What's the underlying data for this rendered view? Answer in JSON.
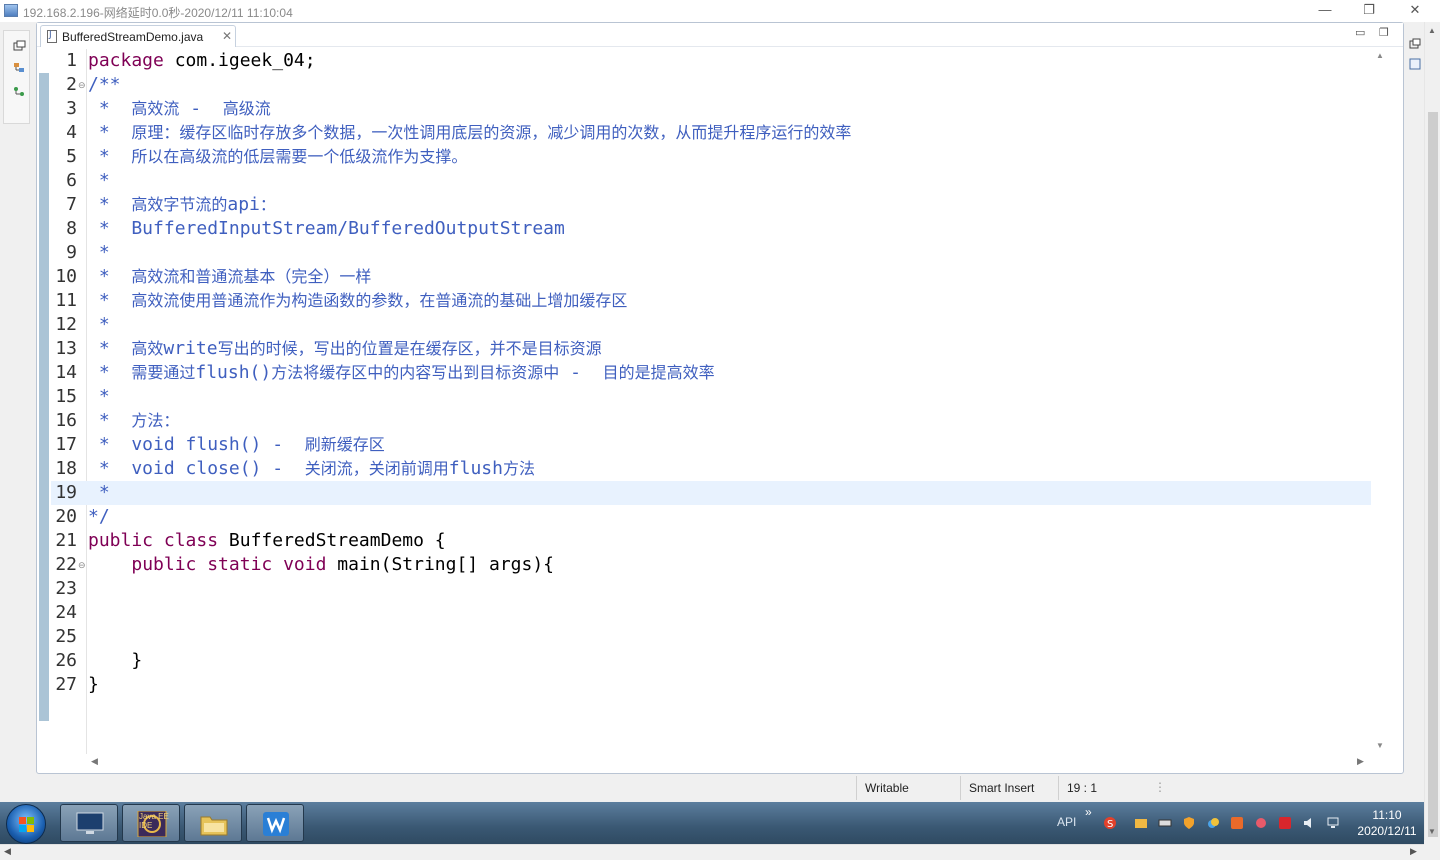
{
  "window": {
    "title": "192.168.2.196-网络延时0.0秒-2020/12/11 11:10:04",
    "minimize_label": "—",
    "restore_label": "❐",
    "close_label": "✕"
  },
  "editor": {
    "tab_label": "BufferedStreamDemo.java",
    "tab_close": "✕",
    "minimize_label": "▭",
    "maximize_label": "❐"
  },
  "code_lines": [
    {
      "n": "1",
      "t": "package com.igeek_04;"
    },
    {
      "n": "2",
      "t": "/**"
    },
    {
      "n": "3",
      "t": " *  高效流 -  高级流"
    },
    {
      "n": "4",
      "t": " *  原理：缓存区临时存放多个数据，一次性调用底层的资源，减少调用的次数，从而提升程序运行的效率"
    },
    {
      "n": "5",
      "t": " *  所以在高级流的低层需要一个低级流作为支撑。"
    },
    {
      "n": "6",
      "t": " *"
    },
    {
      "n": "7",
      "t": " *  高效字节流的api："
    },
    {
      "n": "8",
      "t": " *  BufferedInputStream/BufferedOutputStream"
    },
    {
      "n": "9",
      "t": " *"
    },
    {
      "n": "10",
      "t": " *  高效流和普通流基本（完全）一样"
    },
    {
      "n": "11",
      "t": " *  高效流使用普通流作为构造函数的参数，在普通流的基础上增加缓存区"
    },
    {
      "n": "12",
      "t": " *"
    },
    {
      "n": "13",
      "t": " *  高效write写出的时候，写出的位置是在缓存区，并不是目标资源"
    },
    {
      "n": "14",
      "t": " *  需要通过flush()方法将缓存区中的内容写出到目标资源中 -  目的是提高效率"
    },
    {
      "n": "15",
      "t": " *"
    },
    {
      "n": "16",
      "t": " *  方法："
    },
    {
      "n": "17",
      "t": " *  void flush() -  刷新缓存区"
    },
    {
      "n": "18",
      "t": " *  void close() -  关闭流，关闭前调用flush方法"
    },
    {
      "n": "19",
      "t": " *"
    },
    {
      "n": "20",
      "t": "*/"
    },
    {
      "n": "21",
      "t": "public class BufferedStreamDemo {"
    },
    {
      "n": "22",
      "t": "    public static void main(String[] args){"
    },
    {
      "n": "23",
      "t": ""
    },
    {
      "n": "24",
      "t": ""
    },
    {
      "n": "25",
      "t": ""
    },
    {
      "n": "26",
      "t": "    }"
    },
    {
      "n": "27",
      "t": "}"
    }
  ],
  "statusbar": {
    "writable": "Writable",
    "insert_mode": "Smart Insert",
    "position": "19 : 1"
  },
  "taskbar": {
    "apps": [
      {
        "name": "computer-task",
        "color": "#1c3f6e"
      },
      {
        "name": "java-ee-ide-task",
        "label": "Java EE IDE"
      },
      {
        "name": "file-explorer-task",
        "color": "#e6c35a"
      },
      {
        "name": "wps-writer-task",
        "color": "#2a7fd6"
      }
    ],
    "tray_label": "API",
    "tray_expand": "»",
    "clock_time": "11:10",
    "clock_date": "2020/12/11"
  },
  "colors": {
    "keyword": "#7f0055",
    "javadoc": "#3f5fbf",
    "current_line": "#e8f2fe",
    "change_bar": "#8fb0c8"
  }
}
